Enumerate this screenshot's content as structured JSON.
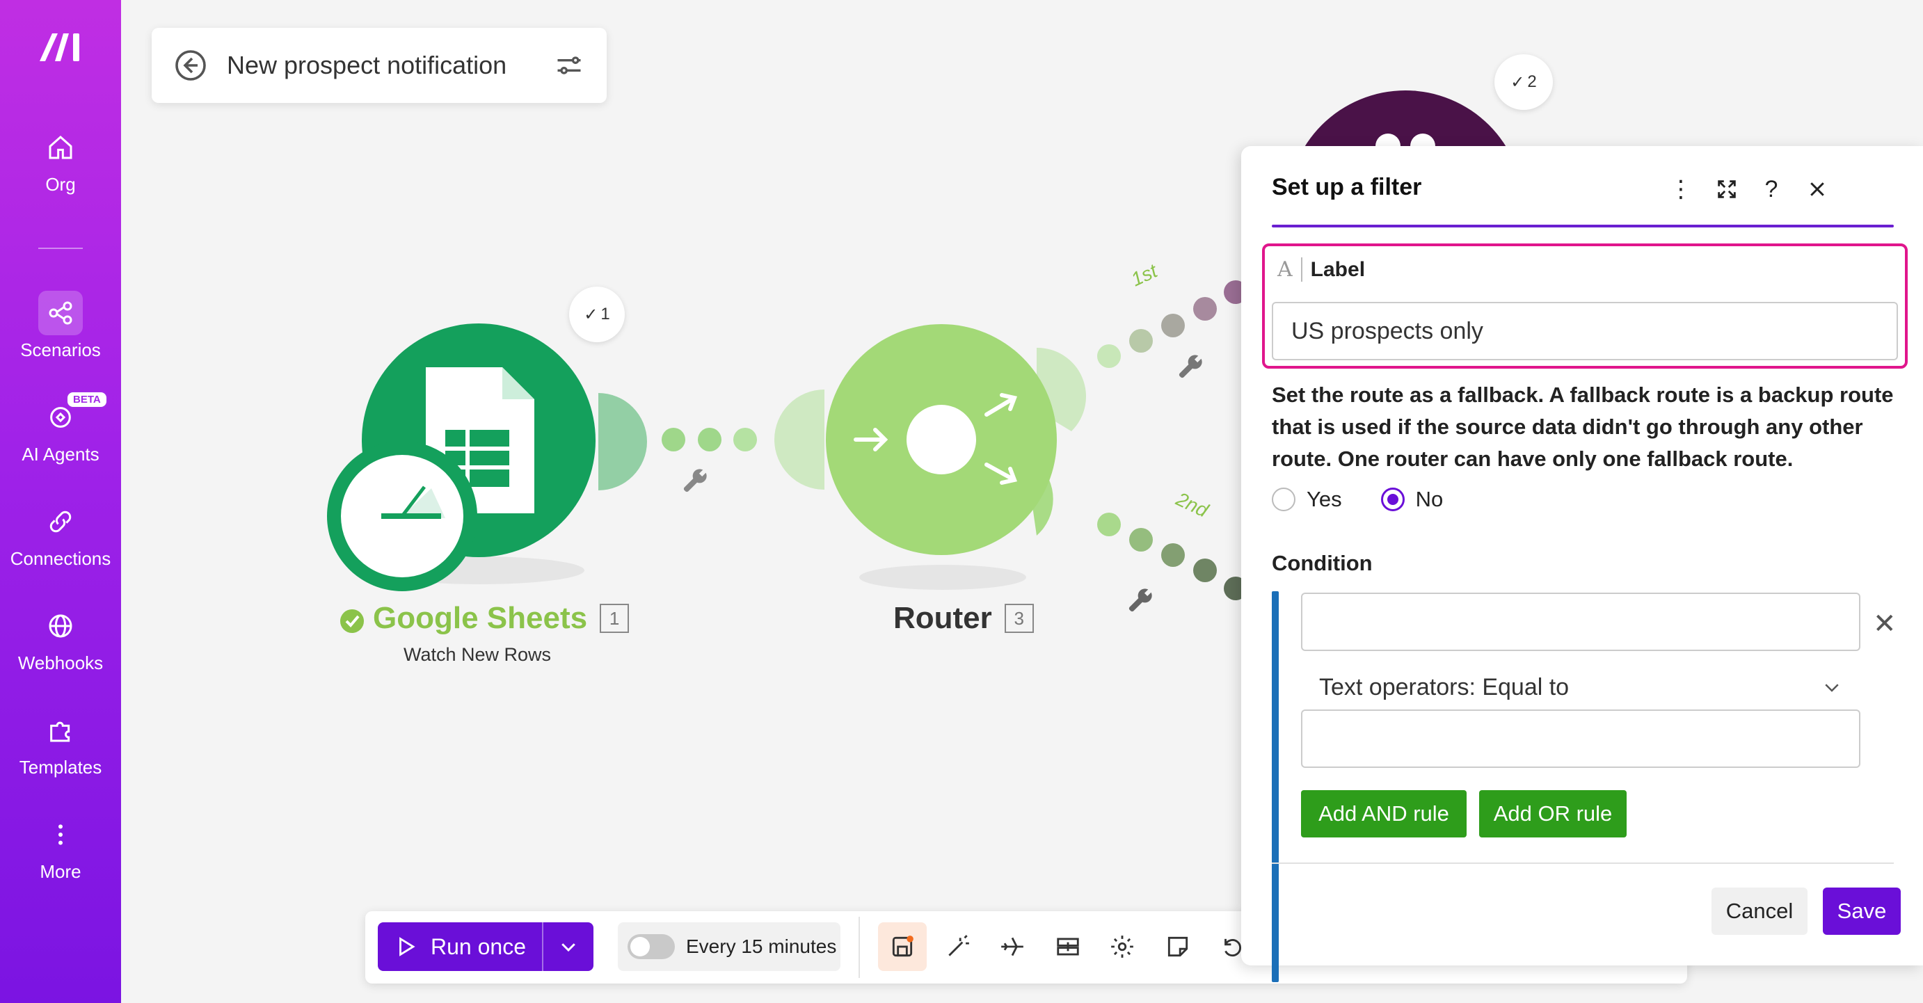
{
  "sidebar": {
    "items": [
      {
        "label": "Org",
        "icon": "home-icon"
      },
      {
        "label": "Scenarios",
        "icon": "share-nodes-icon"
      },
      {
        "label": "AI Agents",
        "icon": "ai-agent-icon",
        "badge": "BETA"
      },
      {
        "label": "Connections",
        "icon": "link-icon"
      },
      {
        "label": "Webhooks",
        "icon": "globe-icon"
      },
      {
        "label": "Templates",
        "icon": "puzzle-icon"
      },
      {
        "label": "More",
        "icon": "more-vertical-icon"
      }
    ]
  },
  "header": {
    "title": "New prospect notification"
  },
  "canvas": {
    "google_sheets": {
      "name": "Google Sheets",
      "id": "1",
      "subtitle": "Watch New Rows",
      "ops_badge": "1"
    },
    "router": {
      "name": "Router",
      "id": "3"
    },
    "top_module_badge": "2",
    "route_labels": [
      "1st",
      "2nd"
    ]
  },
  "toolbar": {
    "run_label": "Run once",
    "schedule_label": "Every 15 minutes"
  },
  "filter_panel": {
    "title": "Set up a filter",
    "label_heading": "Label",
    "label_icon": "A",
    "label_value": "US prospects only",
    "fallback_text": "Set the route as a fallback. A fallback route is a backup route that is used if the source data didn't go through any other route. One router can have only one fallback route.",
    "yes_label": "Yes",
    "no_label": "No",
    "fallback_selected": "No",
    "condition_heading": "Condition",
    "condition_value_a": "",
    "operator": "Text operators: Equal to",
    "condition_value_b": "",
    "add_and_label": "Add AND rule",
    "add_or_label": "Add OR rule",
    "cancel_label": "Cancel",
    "save_label": "Save"
  },
  "colors": {
    "sidebar_top": "#c02ee3",
    "sidebar_bottom": "#7b14e2",
    "primary": "#6a0fd8",
    "sheets_green": "#14a05c",
    "router_green": "#a3d977",
    "label_highlight": "#e0168c",
    "rule_green": "#2e9d1b",
    "condition_bar": "#1b6fb8"
  }
}
